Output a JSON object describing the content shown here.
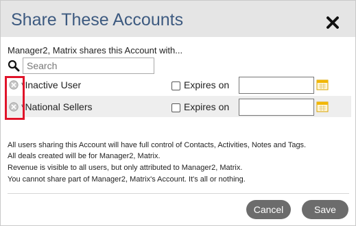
{
  "dialog": {
    "title": "Share These Accounts",
    "subtitle": "Manager2, Matrix shares this Account with...",
    "search": {
      "placeholder": "Search"
    },
    "rows": [
      {
        "name": "*Inactive User",
        "expires_label": "Expires on",
        "date": ""
      },
      {
        "name": "*National Sellers",
        "expires_label": "Expires on",
        "date": ""
      }
    ],
    "info_lines": [
      "All users sharing this Account will have full control of Contacts, Activities, Notes and Tags.",
      "All deals created will be for Manager2, Matrix.",
      "Revenue is visible to all users, but only attributed to Manager2, Matrix.",
      "You cannot share part of Manager2, Matrix's Account. It's all or nothing."
    ],
    "buttons": {
      "cancel": "Cancel",
      "save": "Save"
    }
  },
  "colors": {
    "title": "#3d5a80",
    "titlebar_bg": "#e5e5e5",
    "button_bg": "#6c6c6c",
    "highlight": "#e0142a",
    "calendar": "#f2b705"
  },
  "icons": [
    "close-icon",
    "search-icon",
    "remove-icon",
    "calendar-icon"
  ]
}
